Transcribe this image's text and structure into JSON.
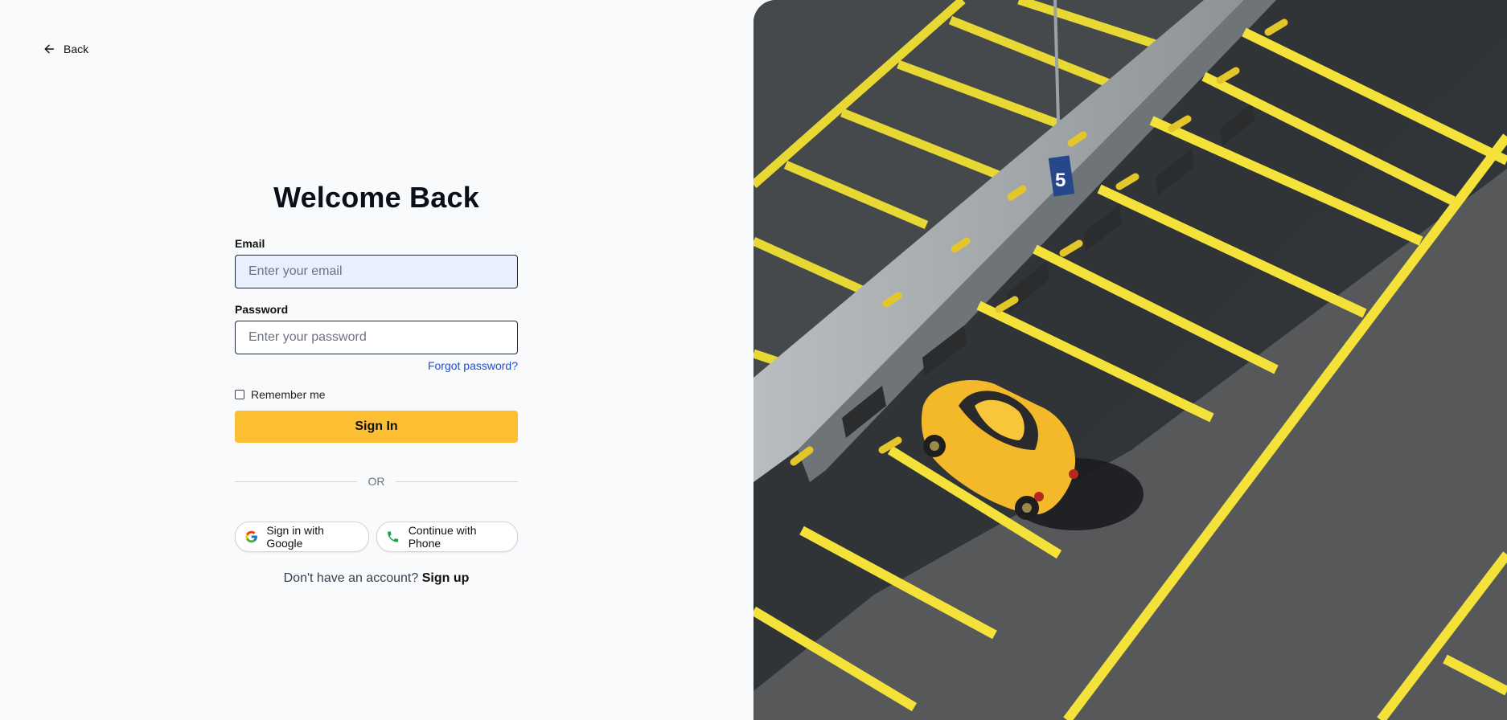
{
  "back": {
    "label": "Back"
  },
  "form": {
    "title": "Welcome Back",
    "email_label": "Email",
    "email_placeholder": "Enter your email",
    "password_label": "Password",
    "password_placeholder": "Enter your password",
    "forgot_label": "Forgot password?",
    "remember_label": "Remember me",
    "signin_label": "Sign In",
    "divider_label": "OR",
    "google_label": "Sign in with Google",
    "phone_label": "Continue with Phone",
    "signup_prompt": "Don't have an account?",
    "signup_link": "Sign up"
  },
  "hero": {
    "sign_number": "5"
  },
  "colors": {
    "accent": "#fcbf34",
    "link": "#1d4ed8"
  }
}
